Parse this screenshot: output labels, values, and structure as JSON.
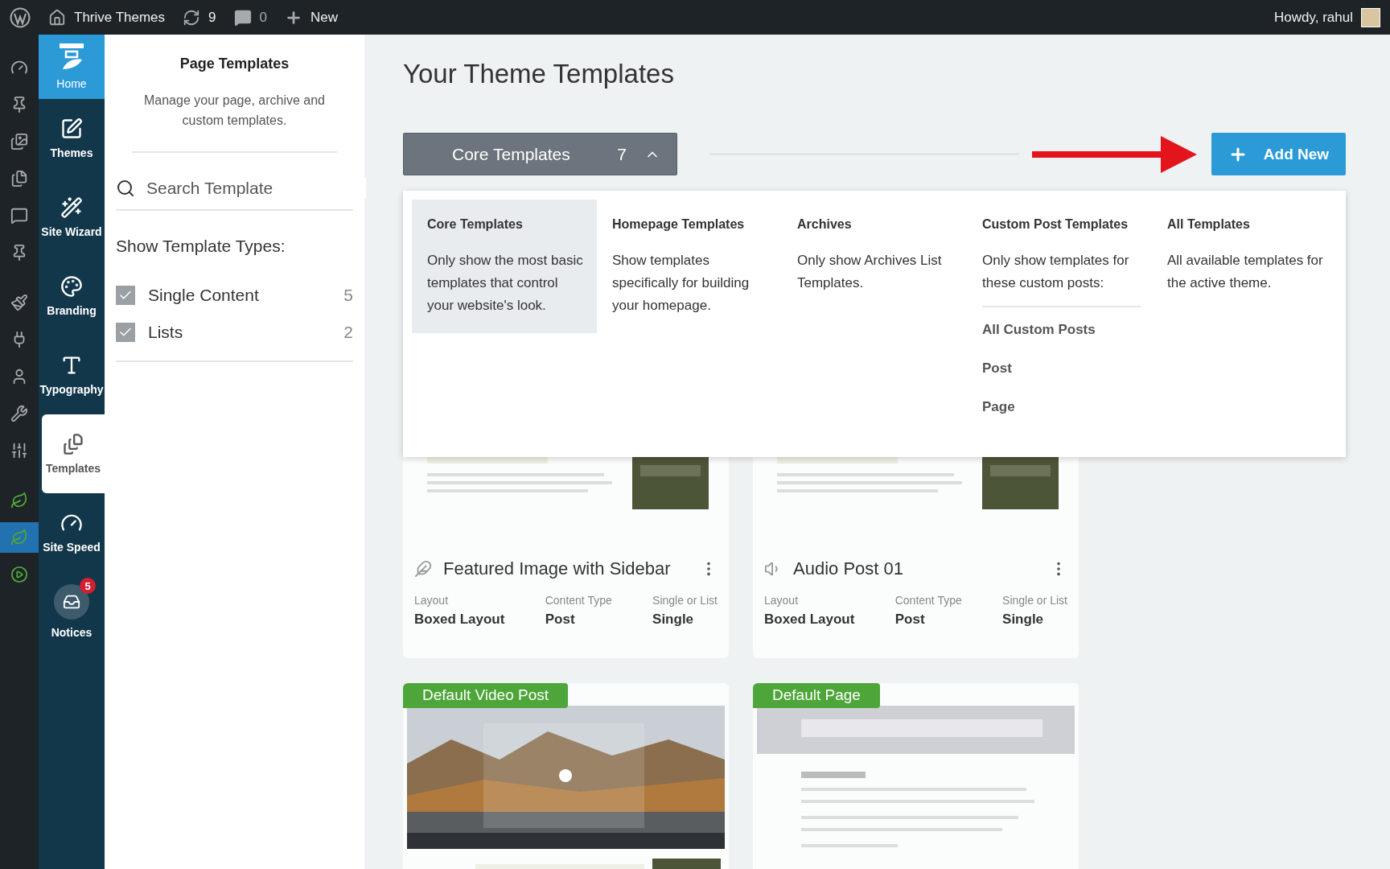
{
  "admin_bar": {
    "site": "Thrive Themes",
    "updates": "9",
    "comments": "0",
    "new": "New",
    "greeting": "Howdy, rahul"
  },
  "admin_menu": [
    {
      "selected": false
    },
    {
      "selected": false
    },
    {
      "selected": false
    },
    {
      "selected": false
    },
    {
      "selected": false
    },
    {
      "selected": false
    },
    {
      "selected": false
    },
    {
      "selected": false
    },
    {
      "selected": false
    },
    {
      "selected": false
    },
    {
      "selected": false
    },
    {
      "selected": false
    },
    {
      "selected": true
    },
    {
      "selected": false
    }
  ],
  "thrive_nav": [
    {
      "label": "Home",
      "kind": "logo",
      "selected": false
    },
    {
      "label": "Themes",
      "kind": "item",
      "selected": false
    },
    {
      "label": "Site Wizard",
      "kind": "item",
      "selected": false
    },
    {
      "label": "Branding",
      "kind": "item",
      "selected": false
    },
    {
      "label": "Typography",
      "kind": "item",
      "selected": false
    },
    {
      "label": "Templates",
      "kind": "item",
      "selected": true
    },
    {
      "label": "Site Speed",
      "kind": "item",
      "selected": false
    },
    {
      "label": "Notices",
      "kind": "notice",
      "selected": false,
      "badge": "5"
    }
  ],
  "panel": {
    "title": "Page Templates",
    "description": "Manage your page, archive and custom templates.",
    "search": {
      "placeholder": "Search Template"
    },
    "types_heading": "Show Template Types:",
    "types": [
      {
        "label": "Single Content",
        "count": "5",
        "checked": true
      },
      {
        "label": "Lists",
        "count": "2",
        "checked": true
      }
    ]
  },
  "main": {
    "title": "Your Theme Templates",
    "filter": {
      "label": "Core Templates",
      "count": "7",
      "expanded": true
    },
    "add_button": "Add New",
    "dropdown": [
      {
        "title": "Core Templates",
        "description": "Only show the most basic templates that control your website's look.",
        "selected": true
      },
      {
        "title": "Homepage Templates",
        "description": "Show templates specifically for building your homepage.",
        "selected": false
      },
      {
        "title": "Archives",
        "description": "Only show Archives List Templates.",
        "selected": false
      },
      {
        "title": "Custom Post Templates",
        "description": "Only show templates for these custom posts:",
        "selected": false,
        "options": [
          "All Custom Posts",
          "Post",
          "Page"
        ]
      },
      {
        "title": "All Templates",
        "description": "All available templates for the active theme.",
        "selected": false
      }
    ],
    "cards": [
      {
        "name": "Featured Image with Sidebar",
        "kind": "feather",
        "meta": [
          {
            "label": "Layout",
            "value": "Boxed Layout"
          },
          {
            "label": "Content Type",
            "value": "Post"
          },
          {
            "label": "Single or List",
            "value": "Single"
          }
        ]
      },
      {
        "name": "Audio Post 01",
        "kind": "audio",
        "meta": [
          {
            "label": "Layout",
            "value": "Boxed Layout"
          },
          {
            "label": "Content Type",
            "value": "Post"
          },
          {
            "label": "Single or List",
            "value": "Single"
          }
        ]
      },
      {
        "badge": "Default Video Post",
        "kind": "video"
      },
      {
        "badge": "Default Page",
        "kind": "page"
      }
    ]
  }
}
